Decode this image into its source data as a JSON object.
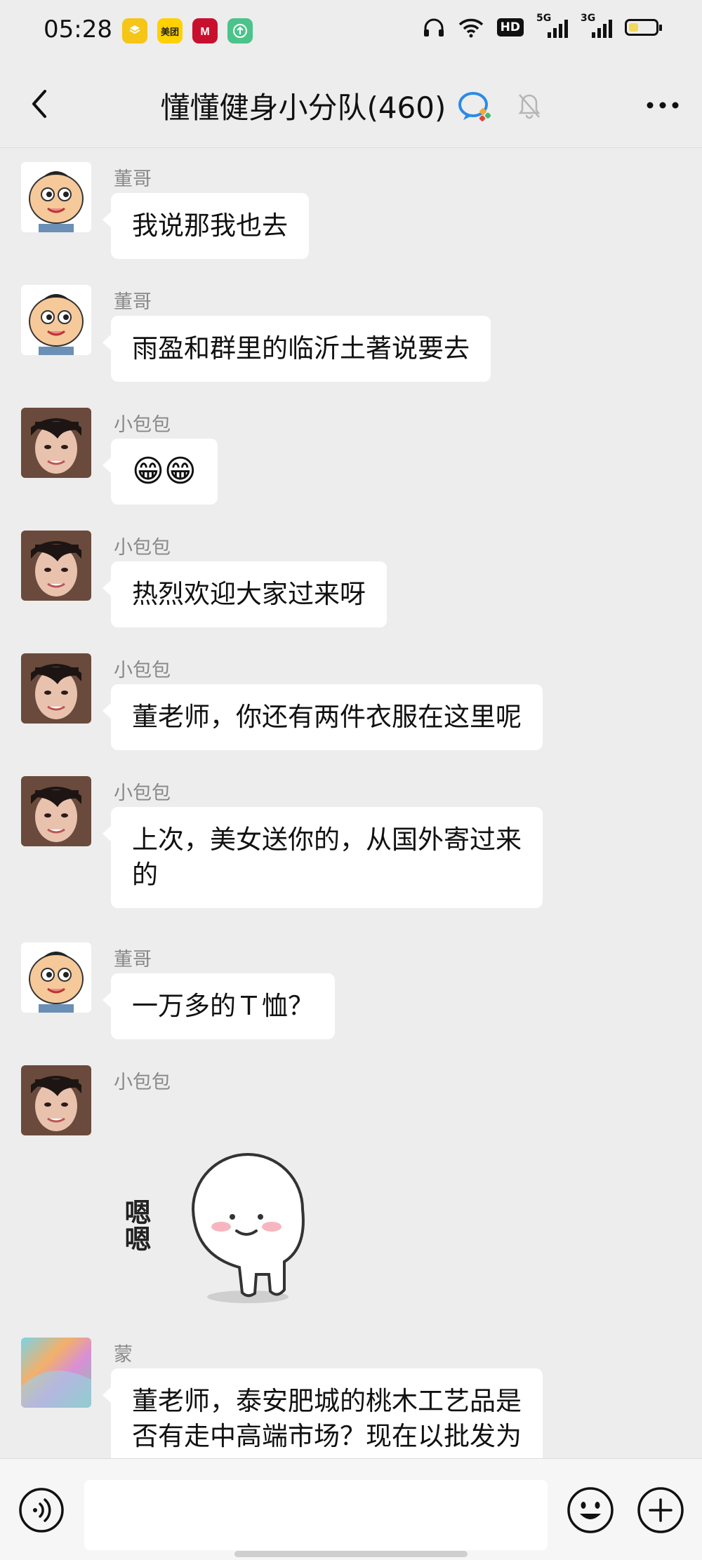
{
  "status_bar": {
    "time": "05:28",
    "apps": [
      {
        "name": "taobao-app-icon",
        "color": "#f5c518"
      },
      {
        "name": "meituan-app-icon",
        "label": "美团",
        "color": "#ffd100"
      },
      {
        "name": "cmb-bank-app-icon",
        "color": "#c8102e"
      },
      {
        "name": "upload-app-icon",
        "color": "#4cc38a"
      }
    ],
    "hd_label": "HD",
    "net1": "5G",
    "net2": "3G",
    "battery_level": 0.35
  },
  "header": {
    "title": "懂懂健身小分队(460)"
  },
  "messages": [
    {
      "sender": "董哥",
      "text": "我说那我也去",
      "avatar": "cartoon-boy"
    },
    {
      "sender": "董哥",
      "text": "雨盈和群里的临沂土著说要去",
      "avatar": "cartoon-boy"
    },
    {
      "sender": "小包包",
      "text": "😁😁",
      "avatar": "girl-photo"
    },
    {
      "sender": "小包包",
      "text": "热烈欢迎大家过来呀",
      "avatar": "girl-photo"
    },
    {
      "sender": "小包包",
      "text": "董老师，你还有两件衣服在这里呢",
      "avatar": "girl-photo"
    },
    {
      "sender": "小包包",
      "text": "上次，美女送你的，从国外寄过来\n的",
      "avatar": "girl-photo"
    },
    {
      "sender": "董哥",
      "text": "一万多的Ｔ恤？",
      "avatar": "cartoon-boy"
    },
    {
      "sender": "小包包",
      "sticker_text": "嗯嗯",
      "avatar": "girl-photo"
    },
    {
      "sender": "蒙",
      "text": "董老师，泰安肥城的桃木工艺品是\n否有走中高端市场？现在以批发为",
      "avatar": "abstract-gradient"
    }
  ],
  "input": {
    "placeholder": ""
  },
  "colors": {
    "background": "#ededed",
    "bubble": "#ffffff",
    "sender": "#888888"
  }
}
